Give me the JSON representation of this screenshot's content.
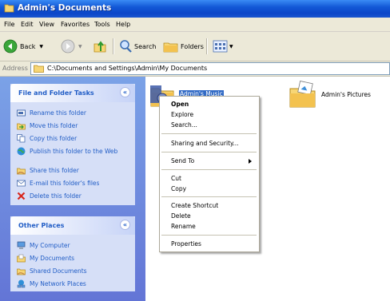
{
  "window": {
    "title": "Admin's Documents"
  },
  "menu": {
    "items": [
      "File",
      "Edit",
      "View",
      "Favorites",
      "Tools",
      "Help"
    ]
  },
  "toolbar": {
    "back_label": "Back",
    "search_label": "Search",
    "folders_label": "Folders"
  },
  "address": {
    "label": "Address",
    "path": "C:\\Documents and Settings\\Admin\\My Documents"
  },
  "tasks_panel": {
    "title": "File and Folder Tasks",
    "items": [
      {
        "label": "Rename this folder",
        "icon": "rename-icon"
      },
      {
        "label": "Move this folder",
        "icon": "move-icon"
      },
      {
        "label": "Copy this folder",
        "icon": "copy-icon"
      },
      {
        "label": "Publish this folder to the Web",
        "icon": "publish-icon"
      },
      {
        "label": "Share this folder",
        "icon": "share-icon"
      },
      {
        "label": "E-mail this folder's files",
        "icon": "email-icon"
      },
      {
        "label": "Delete this folder",
        "icon": "delete-icon"
      }
    ]
  },
  "places_panel": {
    "title": "Other Places",
    "items": [
      {
        "label": "My Computer",
        "icon": "computer-icon"
      },
      {
        "label": "My Documents",
        "icon": "documents-icon"
      },
      {
        "label": "Shared Documents",
        "icon": "shared-folder-icon"
      },
      {
        "label": "My Network Places",
        "icon": "network-icon"
      }
    ]
  },
  "folders": [
    {
      "label": "Admin's Music",
      "selected": true
    },
    {
      "label": "Admin's Pictures",
      "selected": false
    }
  ],
  "context_menu": {
    "items": [
      "Open",
      "Explore",
      "Search...",
      "Sharing and Security...",
      "Send To",
      "Cut",
      "Copy",
      "Create Shortcut",
      "Delete",
      "Rename",
      "Properties"
    ]
  },
  "colors": {
    "title_bar": "#0b46c9",
    "selection": "#316ac5",
    "task_link": "#215dc6"
  }
}
